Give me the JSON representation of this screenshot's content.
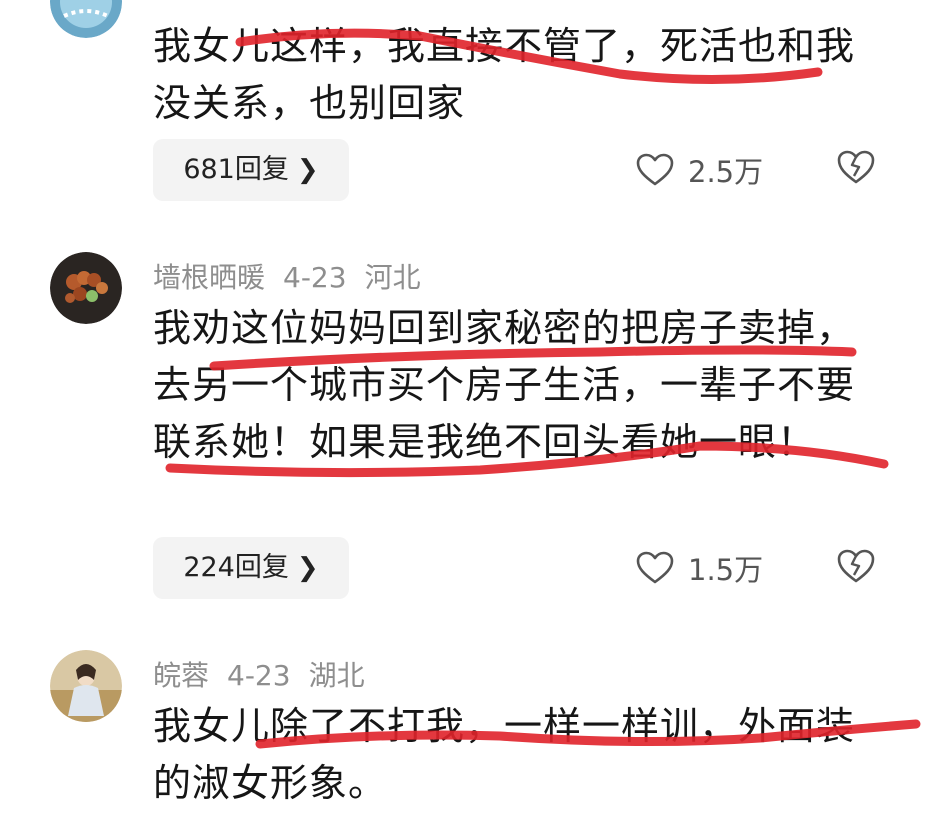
{
  "comments": [
    {
      "username": "",
      "date": "",
      "location": "",
      "text": "我女儿这样，我直接不管了，死活也和我没关系，也别回家",
      "reply_label": "681回复",
      "likes": "2.5万"
    },
    {
      "username": "墙根晒暖",
      "date": "4-23",
      "location": "河北",
      "text": "我劝这位妈妈回到家秘密的把房子卖掉，去另一个城市买个房子生活，一辈子不要联系她！如果是我绝不回头看她一眼！",
      "reply_label": "224回复",
      "likes": "1.5万"
    },
    {
      "username": "皖蓉",
      "date": "4-23",
      "location": "湖北",
      "text": "我女儿除了不打我，一样一样训，外面装的淑女形象。"
    }
  ],
  "icons": {
    "like": "heart-outline-icon",
    "dislike": "broken-heart-icon",
    "chevron": "chevron-right-icon"
  },
  "colors": {
    "highlight_stroke": "#e0222a",
    "meta_text": "#8e8e8e",
    "reply_bg": "#f3f3f3"
  }
}
